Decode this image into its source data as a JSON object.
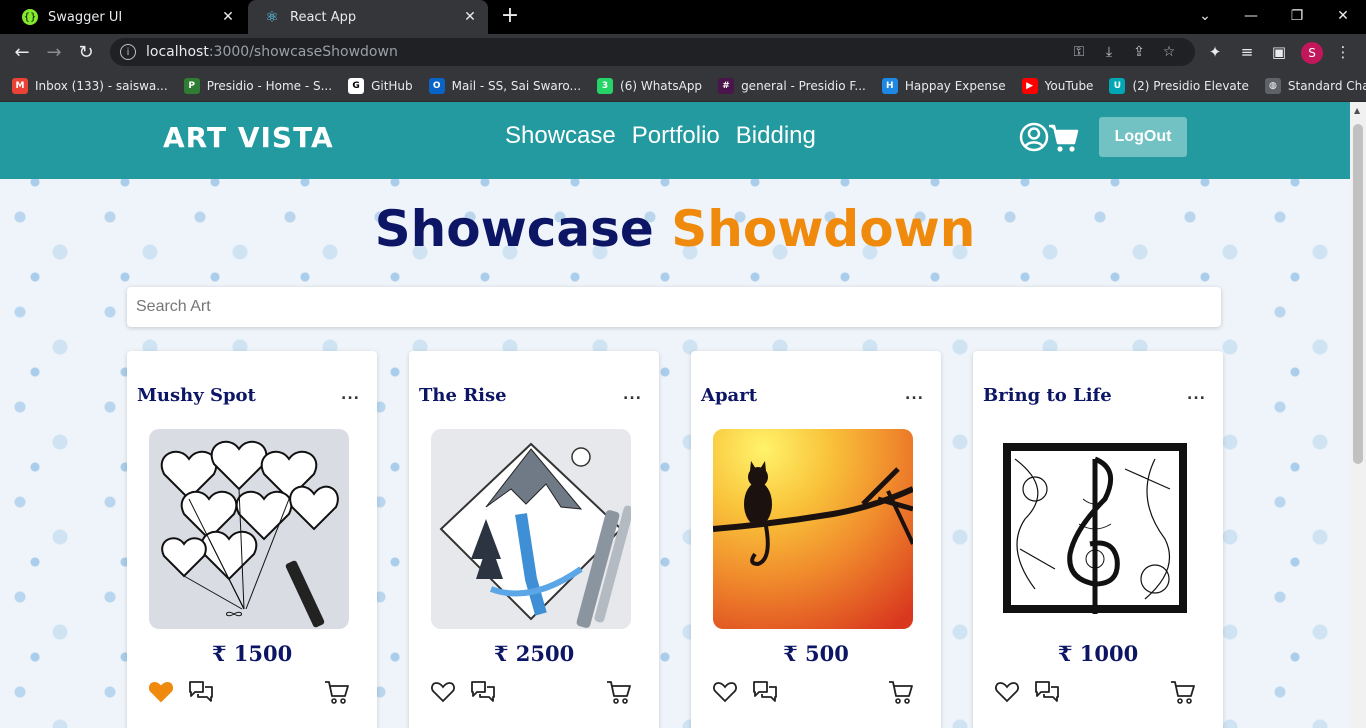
{
  "browser": {
    "tabs": [
      {
        "title": "Swagger UI",
        "active": false
      },
      {
        "title": "React App",
        "active": true
      }
    ],
    "url_host": "localhost",
    "url_rest": ":3000/showcaseShowdown",
    "profile_initial": "S",
    "bookmarks": [
      {
        "label": "Inbox (133) - saiswa...",
        "icon": "gmail-icon",
        "color": "#ea4335",
        "glyph": "M"
      },
      {
        "label": "Presidio - Home - S...",
        "icon": "presidio-icon",
        "color": "#2e7d32",
        "glyph": "P"
      },
      {
        "label": "GitHub",
        "icon": "github-icon",
        "color": "#ffffff",
        "glyph": "G"
      },
      {
        "label": "Mail - SS, Sai Swaro...",
        "icon": "outlook-icon",
        "color": "#0a64c8",
        "glyph": "O"
      },
      {
        "label": "(6) WhatsApp",
        "icon": "whatsapp-icon",
        "color": "#25d366",
        "glyph": "3"
      },
      {
        "label": "general - Presidio F...",
        "icon": "slack-icon",
        "color": "#4a154b",
        "glyph": "#"
      },
      {
        "label": "Happay Expense",
        "icon": "happay-icon",
        "color": "#1e88e5",
        "glyph": "H"
      },
      {
        "label": "YouTube",
        "icon": "youtube-icon",
        "color": "#ff0000",
        "glyph": "▶"
      },
      {
        "label": "(2) Presidio Elevate",
        "icon": "elevate-icon",
        "color": "#00a8b5",
        "glyph": "U"
      },
      {
        "label": "Standard Chartered...",
        "icon": "globe-icon",
        "color": "#5f6368",
        "glyph": "◍"
      }
    ]
  },
  "navbar": {
    "logo": "ART VISTA",
    "links": [
      "Showcase",
      "Portfolio",
      "Bidding"
    ],
    "logout": "LogOut"
  },
  "heading": {
    "part1": "Showcase",
    "part2": "Showdown"
  },
  "search": {
    "placeholder": "Search Art",
    "value": ""
  },
  "cards": [
    {
      "title": "Mushy Spot",
      "menu": "...",
      "price": "₹ 1500",
      "liked": true,
      "art": "heart-balloons-zentangle"
    },
    {
      "title": "The Rise",
      "menu": "...",
      "price": "₹ 2500",
      "liked": false,
      "art": "mountain-waterfall-sketch"
    },
    {
      "title": "Apart",
      "menu": "...",
      "price": "₹ 500",
      "liked": false,
      "art": "cat-on-branch-sunset"
    },
    {
      "title": "Bring to Life",
      "menu": "...",
      "price": "₹ 1000",
      "liked": false,
      "art": "treble-clef-zentangle"
    }
  ],
  "colors": {
    "navbar": "#229a9f",
    "logout_button": "#72c2c4",
    "heading_primary": "#0d1565",
    "heading_accent": "#f08a0c",
    "liked_heart": "#f08a0c"
  }
}
